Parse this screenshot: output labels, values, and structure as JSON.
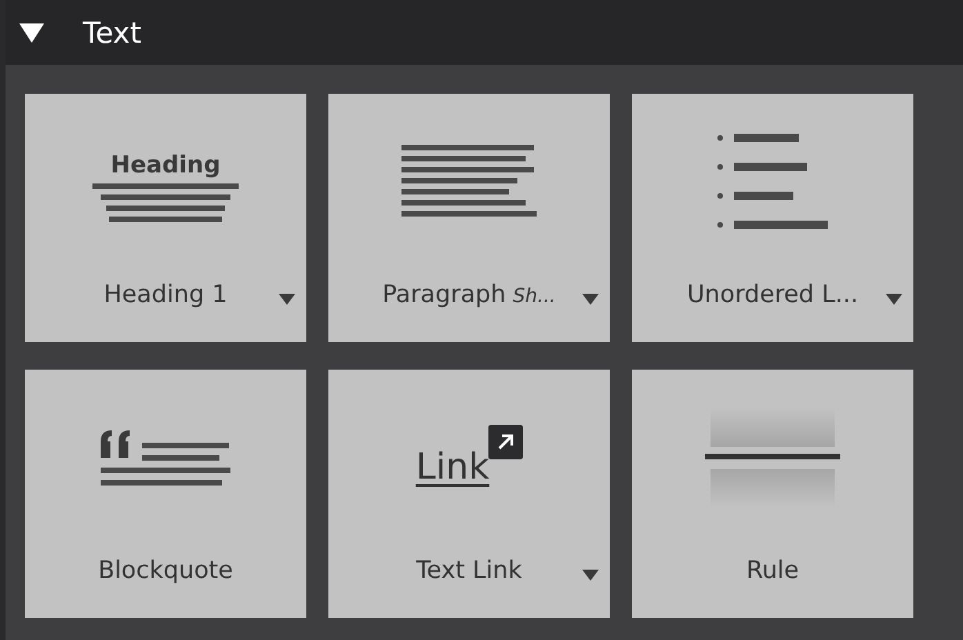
{
  "section": {
    "title": "Text",
    "expanded": true
  },
  "tiles": [
    {
      "kind": "heading",
      "label": "Heading 1",
      "preview_text": "Heading",
      "has_menu": true
    },
    {
      "kind": "paragraph",
      "label": "Paragraph",
      "sublabel": "Sh...",
      "has_menu": true
    },
    {
      "kind": "list",
      "label": "Unordered L...",
      "has_menu": true
    },
    {
      "kind": "blockquote",
      "label": "Blockquote",
      "has_menu": false
    },
    {
      "kind": "link",
      "label": "Text Link",
      "preview_text": "Link",
      "has_menu": true
    },
    {
      "kind": "rule",
      "label": "Rule",
      "has_menu": false
    }
  ]
}
